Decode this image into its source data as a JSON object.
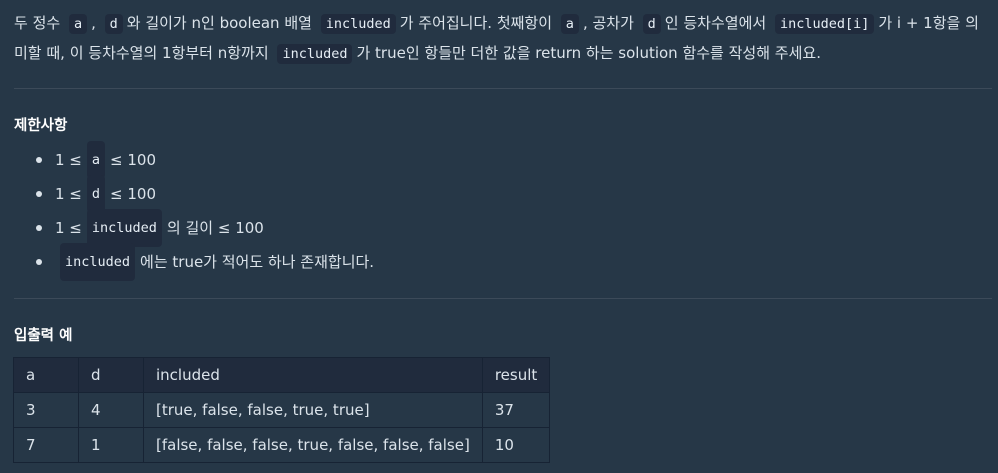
{
  "description": {
    "line1": [
      {
        "t": "text",
        "v": "두 정수 "
      },
      {
        "t": "code",
        "v": "a"
      },
      {
        "t": "text",
        "v": ", "
      },
      {
        "t": "code",
        "v": "d"
      },
      {
        "t": "text",
        "v": "와 길이가 n인 boolean 배열 "
      },
      {
        "t": "code",
        "v": "included"
      },
      {
        "t": "text",
        "v": "가 주어집니다. 첫째항이 "
      },
      {
        "t": "code",
        "v": "a"
      },
      {
        "t": "text",
        "v": ", 공차가 "
      },
      {
        "t": "code",
        "v": "d"
      },
      {
        "t": "text",
        "v": "인 등차수열에서 "
      },
      {
        "t": "code",
        "v": "included[i]"
      },
      {
        "t": "text",
        "v": "가 i + 1항을 의"
      }
    ],
    "line2": [
      {
        "t": "text",
        "v": "미할 때, 이 등차수열의 1항부터 n항까지 "
      },
      {
        "t": "code",
        "v": "included"
      },
      {
        "t": "text",
        "v": "가 true인 항들만 더한 값을 return 하는 solution 함수를 작성해 주세요."
      }
    ]
  },
  "constraints_heading": "제한사항",
  "constraints": [
    [
      {
        "t": "text",
        "v": "1 ≤ "
      },
      {
        "t": "code",
        "v": "a"
      },
      {
        "t": "text",
        "v": " ≤ 100"
      }
    ],
    [
      {
        "t": "text",
        "v": "1 ≤ "
      },
      {
        "t": "code",
        "v": "d"
      },
      {
        "t": "text",
        "v": " ≤ 100"
      }
    ],
    [
      {
        "t": "text",
        "v": "1 ≤ "
      },
      {
        "t": "code",
        "v": "included"
      },
      {
        "t": "text",
        "v": "의 길이 ≤ 100"
      }
    ],
    [
      {
        "t": "code",
        "v": "included"
      },
      {
        "t": "text",
        "v": "에는 true가 적어도 하나 존재합니다."
      }
    ]
  ],
  "examples_heading": "입출력 예",
  "table": {
    "headers": [
      "a",
      "d",
      "included",
      "result"
    ],
    "rows": [
      [
        "3",
        "4",
        "[true, false, false, true, true]",
        "37"
      ],
      [
        "7",
        "1",
        "[false, false, false, true, false, false, false]",
        "10"
      ]
    ]
  }
}
